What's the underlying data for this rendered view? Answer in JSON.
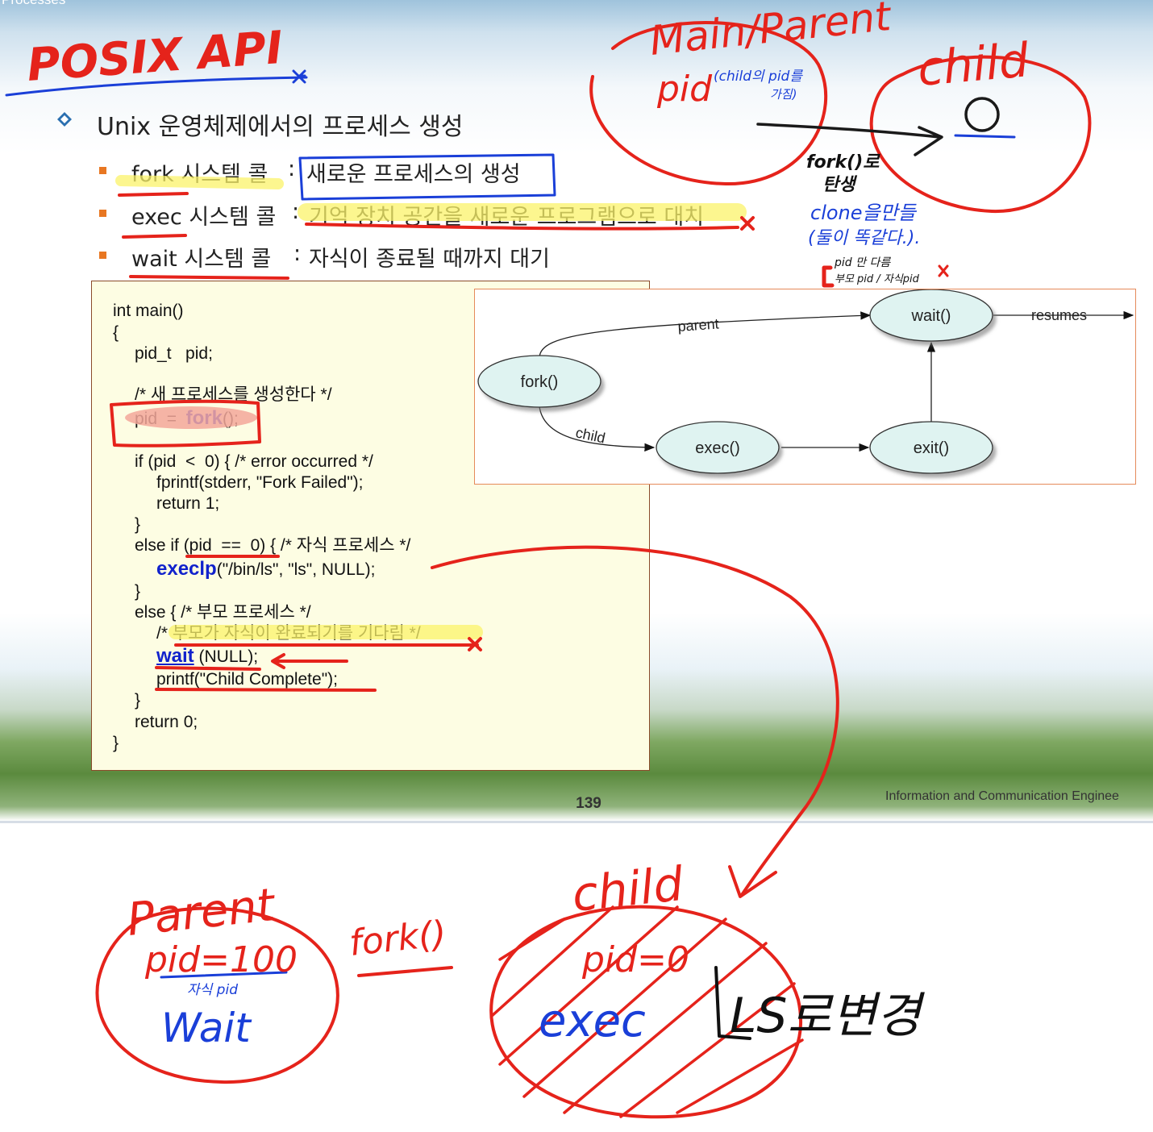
{
  "slide": {
    "header": "Processes",
    "title_bullet": "Unix 운영체제에서의 프로세스 생성",
    "items": [
      {
        "name": "fork",
        "label": "시스템 콜",
        "desc": "새로운 프로세스의 생성"
      },
      {
        "name": "exec",
        "label": "시스템 콜",
        "desc": "기억 장치 공간을 새로운 프로그램으로 대치"
      },
      {
        "name": "wait",
        "label": "시스템 콜",
        "desc": "자식이 종료될 때까지 대기"
      }
    ],
    "separator": ":",
    "code": {
      "l1": "int main()",
      "l2": "{",
      "l3": "pid_t   pid;",
      "l4": "/* 새 프로세스를 생성한다 */",
      "l5a": "pid  =  ",
      "l5kw": "fork",
      "l5b": "();",
      "l6": "if (pid  <  0) { /* error occurred */",
      "l7": "fprintf(stderr, \"Fork Failed\");",
      "l8": "return 1;",
      "l9": "}",
      "l10": "else if (pid  ==  0) { /* 자식 프로세스 */",
      "l11kw": "execlp",
      "l11b": "(\"/bin/ls\", \"ls\", NULL);",
      "l12": "}",
      "l13": "else { /* 부모 프로세스 */",
      "l14": "/* 부모가 자식이 완료되기를 기다림 */",
      "l15kw": "wait",
      "l15b": " (NULL);",
      "l16": "printf(\"Child Complete\");",
      "l17": "}",
      "l18": "return 0;",
      "l19": "}"
    },
    "diagram": {
      "nodes": [
        "fork()",
        "wait()",
        "exec()",
        "exit()"
      ],
      "edge_parent": "parent",
      "edge_child": "child",
      "resumes": "resumes"
    },
    "page_number": "139",
    "footer": "Information and Communication Enginee"
  },
  "annotations": {
    "posix": "POSIX API",
    "main_parent": "Main/Parent",
    "pid": "pid",
    "pid_note_1": "(child의 pid를",
    "pid_note_2": "가짐)",
    "child_top": "child",
    "zero": "0",
    "fork_note_1": "fork()로",
    "fork_note_2": "탄생",
    "clone_1": "clone을만들",
    "clone_2": "(둘이 똑같다.).",
    "pid_diff_1": "pid 만 다름",
    "pid_diff_2": "부모 pid / 자식pid",
    "parent_bottom": "Parent",
    "pid100": "pid=100",
    "child_pid": "자식 pid",
    "wait_bottom": "Wait",
    "fork_bottom": "fork()",
    "child_bottom": "child",
    "pid0": "pid=0",
    "exec_bottom": "exec",
    "ls_note": "LS로변경"
  },
  "colors": {
    "red_ink": "#e5231b",
    "blue_ink": "#1a3fd8",
    "highlight": "#fbf36a",
    "keyword": "#1122cc",
    "bullet_square": "#e87722",
    "node_fill": "#dff3f1"
  }
}
